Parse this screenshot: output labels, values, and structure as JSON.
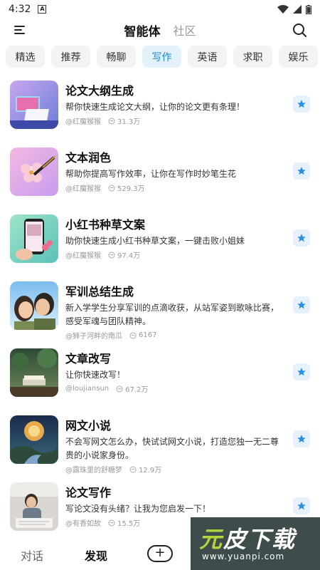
{
  "status": {
    "time": "4:32"
  },
  "header": {
    "tabs": [
      {
        "label": "智能体",
        "active": true
      },
      {
        "label": "社区",
        "active": false
      }
    ]
  },
  "categories": [
    {
      "label": "精选"
    },
    {
      "label": "推荐"
    },
    {
      "label": "畅聊"
    },
    {
      "label": "写作",
      "active": true
    },
    {
      "label": "英语"
    },
    {
      "label": "求职"
    },
    {
      "label": "娱乐"
    }
  ],
  "agents": [
    {
      "title": "论文大纲生成",
      "desc": "帮你快速生成论文大纲，让你的论文更有条理！",
      "author": "@红魔猴猴",
      "count": "31.3万"
    },
    {
      "title": "文本润色",
      "desc": "帮助你提高写作效率，让你在写作时妙笔生花",
      "author": "@红魔猴猴",
      "count": "529.3万"
    },
    {
      "title": "小红书种草文案",
      "desc": "助你快速生成小红书种草文案，一键击败小姐妹",
      "author": "@红魔猴猴",
      "count": "97.4万"
    },
    {
      "title": "军训总结生成",
      "desc": "新入学学生分享军训的点滴收获，从站军姿到歌咏比赛，感受军魂与团队精神。",
      "author": "@狮子河畔的南瓜",
      "count": "6167"
    },
    {
      "title": "文章改写",
      "desc": "让你快速改写！",
      "author": "@loujiansun",
      "count": "67.2万"
    },
    {
      "title": "网文小说",
      "desc": "不会写网文怎么办，快试试网文小说，打造您独一无二尊贵的小说家身份。",
      "author": "@露珠里的舒糖梦",
      "count": "12.9万"
    },
    {
      "title": "论文写作",
      "desc": "写论文没有头绪？让我为您启发一下！",
      "author": "@有香如故",
      "count": "15.5万"
    }
  ],
  "bottom_nav": {
    "dialog": "对话",
    "discover": "发现",
    "add": "+"
  },
  "watermark": {
    "title_part1": "元",
    "title_part2": "皮下载",
    "url": "www.yuanpi.com"
  },
  "colors": {
    "accent": "#1a8ad4",
    "chip_bg": "#f2f3f5",
    "chip_active_bg": "#e3f1fb"
  }
}
